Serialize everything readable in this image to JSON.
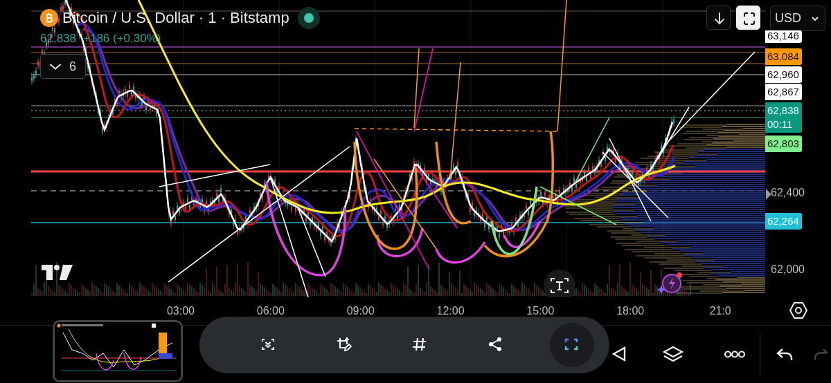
{
  "header": {
    "title": "Bitcoin / U.S. Dollar · 1 · Bitstamp",
    "market_open": true,
    "last_price": "62,838",
    "change": "+186 (+0.30%)",
    "indicators_toggle": {
      "count": "6",
      "expanded": false
    }
  },
  "top_controls": {
    "fullscreen_active": true,
    "currency": "USD"
  },
  "price_tags": [
    {
      "label": "63,146",
      "color": "#ffffff"
    },
    {
      "label": "63,084",
      "color": "#ff9800"
    },
    {
      "label": "62,960",
      "color": "#ffffff"
    },
    {
      "label": "62,867",
      "color": "#ffffff"
    },
    {
      "label": "62,838",
      "sub": "00:11",
      "color": "#089981"
    },
    {
      "label": "62,803",
      "color": "#7ff08c"
    },
    {
      "label": "62,264",
      "color": "#22bfd8"
    }
  ],
  "price_ticks": [
    "62,400",
    "62,000"
  ],
  "time_axis": [
    "03:00",
    "06:00",
    "09:00",
    "12:00",
    "15:00",
    "18:00",
    "21:0"
  ],
  "capture_toolbar": [
    {
      "kind": "scroll",
      "selected": false
    },
    {
      "kind": "crop",
      "selected": false
    },
    {
      "kind": "tag",
      "selected": false
    },
    {
      "kind": "share",
      "selected": false
    },
    {
      "kind": "capture",
      "selected": true
    }
  ]
}
